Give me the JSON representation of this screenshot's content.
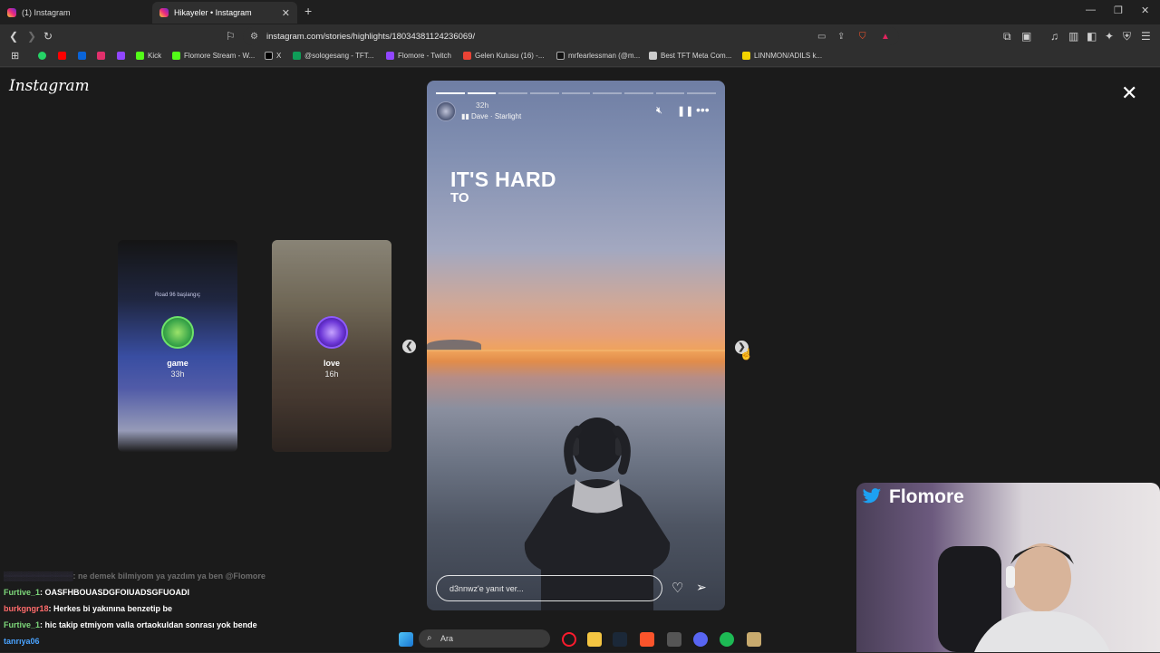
{
  "browser": {
    "tabs": [
      {
        "label": "(1) Instagram",
        "active": false
      },
      {
        "label": "Hikayeler • Instagram",
        "active": true
      }
    ],
    "url": "instagram.com/stories/highlights/18034381124236069/",
    "bookmarks": [
      {
        "label": "",
        "icon": "whatsapp-icon",
        "color": "#25d366"
      },
      {
        "label": "",
        "icon": "youtube-icon",
        "color": "#ff0000"
      },
      {
        "label": "",
        "icon": "outlook-icon",
        "color": "#0a64d8"
      },
      {
        "label": "",
        "icon": "instagram-icon",
        "color": "#e1306c"
      },
      {
        "label": "",
        "icon": "twitch-icon",
        "color": "#9146ff"
      },
      {
        "label": "Kick",
        "icon": "kick-icon",
        "color": "#53fc18"
      },
      {
        "label": "Flomore Stream - W...",
        "icon": "kick-icon",
        "color": "#53fc18"
      },
      {
        "label": "X",
        "icon": "x-icon",
        "color": "#ffffff"
      },
      {
        "label": "@sologesang - TFT...",
        "icon": "sheets-icon",
        "color": "#0f9d58"
      },
      {
        "label": "Flomore - Twitch",
        "icon": "twitch-icon",
        "color": "#9146ff"
      },
      {
        "label": "Gelen Kutusu (16) -...",
        "icon": "gmail-icon",
        "color": "#ea4335"
      },
      {
        "label": "mrfearlessman (@m...",
        "icon": "tiktok-icon",
        "color": "#ffffff"
      },
      {
        "label": "Best TFT Meta Com...",
        "icon": "tft-icon",
        "color": "#cccccc"
      },
      {
        "label": "LINNMON/ADILS k...",
        "icon": "ikea-icon",
        "color": "#f2d300"
      }
    ]
  },
  "instagram": {
    "logo": "Instagram",
    "previews": [
      {
        "name": "game",
        "time": "33h",
        "caption": "Road 96 başlangıç"
      },
      {
        "name": "love",
        "time": "16h"
      }
    ],
    "story": {
      "time": "32h",
      "music": "Dave · Starlight",
      "heading1": "IT'S HARD",
      "heading2": "TO",
      "reply_placeholder": "d3nnwz'e yanıt ver...",
      "progress_total": 9,
      "progress_done": 2
    }
  },
  "chat": [
    {
      "user": "",
      "msg": ": ne demek bilmiyom ya yazdım ya ben @Flomore",
      "faded": true
    },
    {
      "user": "Furtive_1",
      "msg": ": OASFHBOUASDGFOIUADSGFUOADI"
    },
    {
      "user": "burkgngr18",
      "msg": ": Herkes bi yakınına benzetip be"
    },
    {
      "user": "Furtive_1",
      "msg": ": hic takip etmiyom valla ortaokuldan sonrası yok bende"
    },
    {
      "user": "tanrıya06",
      "msg": ""
    }
  ],
  "webcam": {
    "name": "Flomore"
  },
  "taskbar": {
    "search_placeholder": "Ara"
  },
  "colors": {
    "chat_user": "#7dd77a",
    "viewer_bg": "#1b1b1b"
  }
}
